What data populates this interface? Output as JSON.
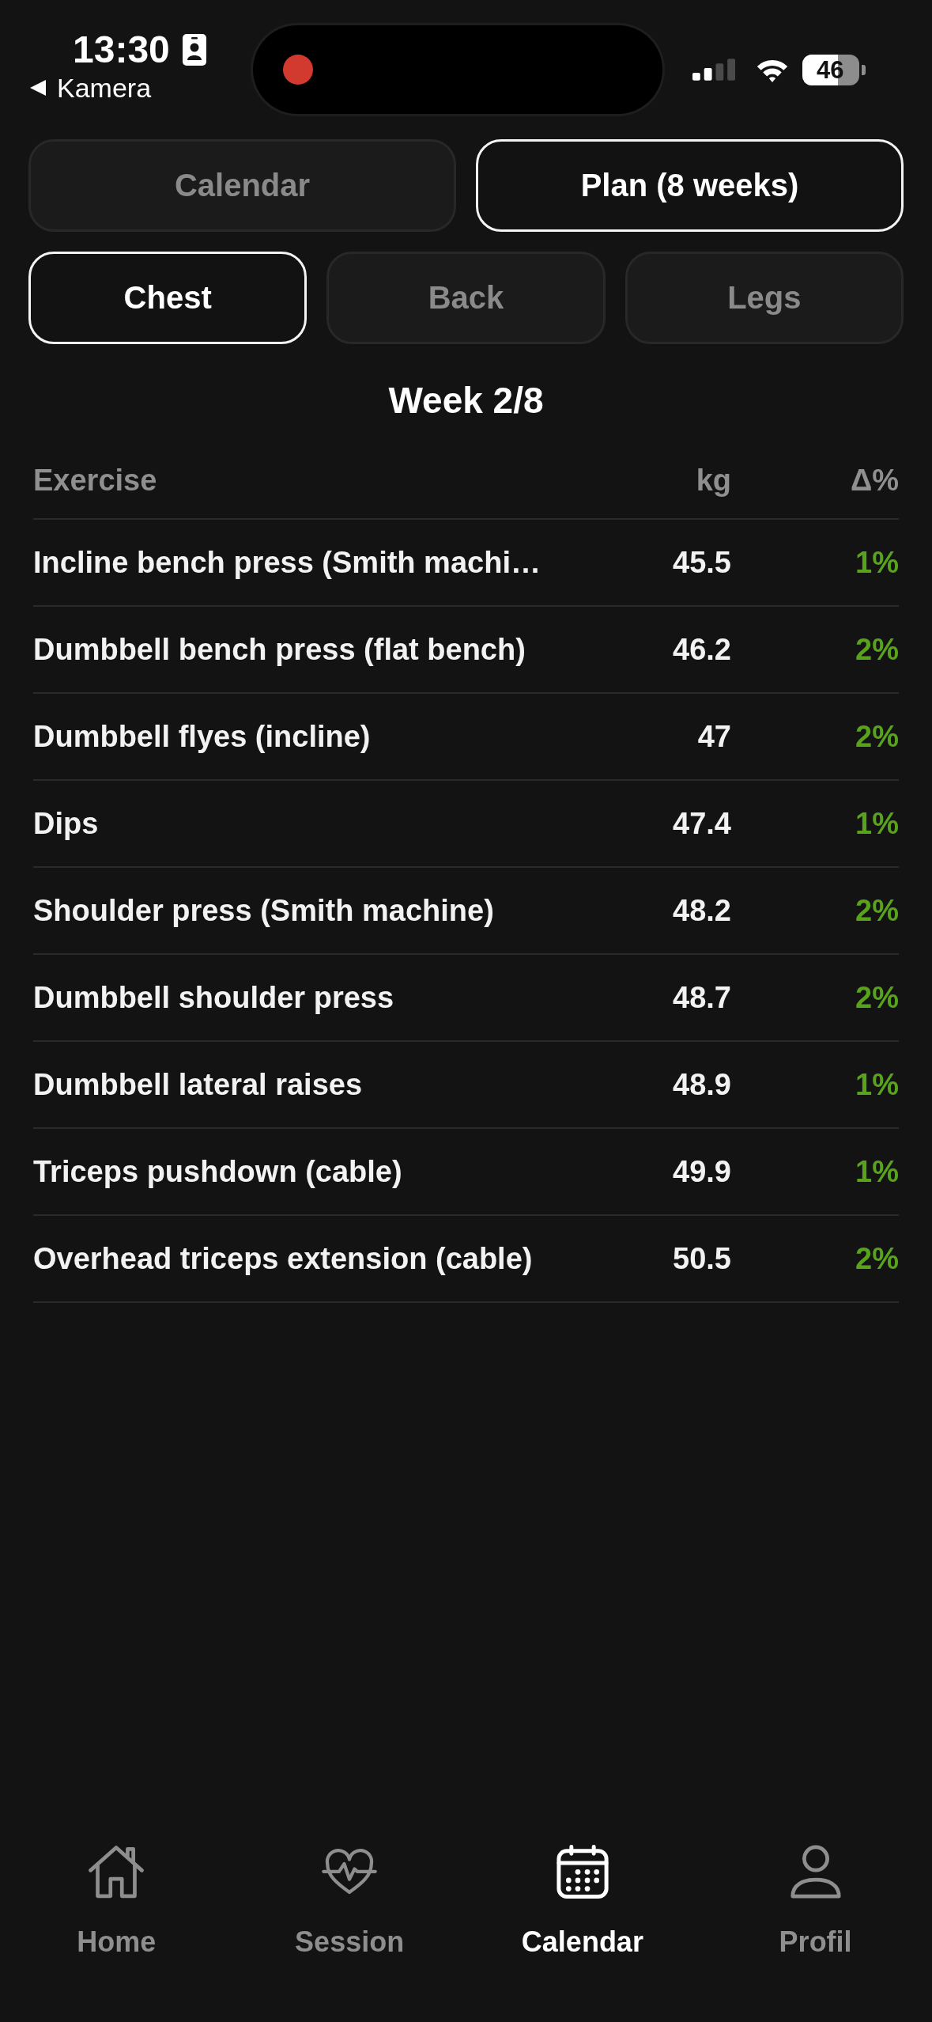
{
  "status_bar": {
    "time": "13:30",
    "back_link": "Kamera",
    "recording": true,
    "battery": "46"
  },
  "view_tabs": [
    {
      "label": "Calendar",
      "selected": false
    },
    {
      "label": "Plan (8 weeks)",
      "selected": true
    }
  ],
  "muscle_tabs": [
    {
      "label": "Chest",
      "selected": true
    },
    {
      "label": "Back",
      "selected": false
    },
    {
      "label": "Legs",
      "selected": false
    }
  ],
  "week_title": "Week 2/8",
  "table": {
    "columns": [
      "Exercise",
      "kg",
      "Δ%"
    ],
    "rows": [
      {
        "exercise": "Incline bench press (Smith machi…",
        "kg": "45.5",
        "change": "1%"
      },
      {
        "exercise": "Dumbbell bench press (flat bench)",
        "kg": "46.2",
        "change": "2%"
      },
      {
        "exercise": "Dumbbell flyes (incline)",
        "kg": "47",
        "change": "2%"
      },
      {
        "exercise": "Dips",
        "kg": "47.4",
        "change": "1%"
      },
      {
        "exercise": "Shoulder press (Smith machine)",
        "kg": "48.2",
        "change": "2%"
      },
      {
        "exercise": "Dumbbell shoulder press",
        "kg": "48.7",
        "change": "2%"
      },
      {
        "exercise": "Dumbbell lateral raises",
        "kg": "48.9",
        "change": "1%"
      },
      {
        "exercise": "Triceps pushdown (cable)",
        "kg": "49.9",
        "change": "1%"
      },
      {
        "exercise": "Overhead triceps extension (cable)",
        "kg": "50.5",
        "change": "2%"
      }
    ]
  },
  "tab_bar": [
    {
      "label": "Home",
      "selected": false
    },
    {
      "label": "Session",
      "selected": false
    },
    {
      "label": "Calendar",
      "selected": true
    },
    {
      "label": "Profil",
      "selected": false
    }
  ]
}
